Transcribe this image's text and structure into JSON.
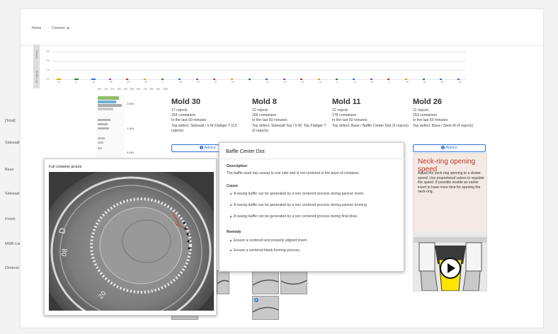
{
  "nav": {
    "home": "Home",
    "connect": "Connect"
  },
  "top_chart": {
    "label_sorted": "Sorted",
    "label_identity": "ID Layout",
    "yticks": [
      "3%",
      "2%",
      "1%",
      "0%",
      "1%",
      "0%"
    ],
    "x_ticks": [
      "20",
      "8",
      "11",
      "26",
      "50",
      "32",
      "1",
      "18",
      "34",
      "23",
      "24",
      "7",
      "21",
      "31",
      "22",
      "10",
      "2",
      "13",
      "29",
      "4",
      "20",
      "15",
      "18",
      "36"
    ]
  },
  "heat_header": [
    "0%",
    "1%",
    "2%",
    "3%",
    "4%",
    "5%",
    "6%",
    "7%",
    "8%",
    "9%",
    "10%"
  ],
  "rows": [
    "[Total]",
    "Sidewall",
    "Base",
    "Sidewall",
    "Finish",
    "MNR-Lis",
    "Dimensi"
  ],
  "pcts": [
    "2.65%",
    "1.16%",
    "0.09%"
  ],
  "molds": [
    {
      "name": "Mold 30",
      "rejects": "17 rejects",
      "containers": "254 containers",
      "period": "In the last 60 minutes",
      "defect": "Top defect: Sidewall / 5 W Fädiger T (13 rejects)"
    },
    {
      "name": "Mold 8",
      "rejects": "12 rejects",
      "containers": "256 containers",
      "period": "In the last 60 minutes",
      "defect": "Top defect: Sidewall-Top / 5 W- Top Fädiger T (6 rejects)"
    },
    {
      "name": "Mold 11",
      "rejects": "12 rejects",
      "containers": "278 containers",
      "period": "In the last 60 minutes",
      "defect": "Top defect: Base / Baffle Center Dist (5 rejects)"
    },
    {
      "name": "Mold 26",
      "rejects": "11 rejects",
      "containers": "253 containers",
      "period": "In the last 60 minutes",
      "defect": "Top defect: Base / Stein M (4 rejects)"
    }
  ],
  "advice_label": "Advice",
  "full_picture": {
    "title": "Full container picture"
  },
  "description": {
    "title": "Baffle Center Dist",
    "desc_heading": "Description",
    "desc_text": "The baffle mark has swung to one side and is not centered in the base of container.",
    "cause_heading": "Cause",
    "causes": [
      "A swung baffle can be generated by a non centered process during parison invert.",
      "A swung baffle can be generated by a non centered process during parison forming.",
      "A swung baffle can be generated by a non centered process during final blow."
    ],
    "remedy_heading": "Remedy",
    "remedies": [
      "Ensure a centered and properly aligned invert.",
      "Ensure a centered blank forming process."
    ]
  },
  "neck_ring": {
    "title": "Neck-ring opening speed",
    "text": "Adjust the neck-ring opening to a slower speed. Use proportional valves to regulate the speed. If possible enable an earlier invert to have more time for opening the neck-ring."
  },
  "thumb_tags": [
    "B",
    "B"
  ],
  "colors": {
    "accent": "#2a6fd6",
    "neck_title": "#c0392b",
    "neck_bg": "#f4e9e3",
    "yellow": "#ffe400"
  }
}
